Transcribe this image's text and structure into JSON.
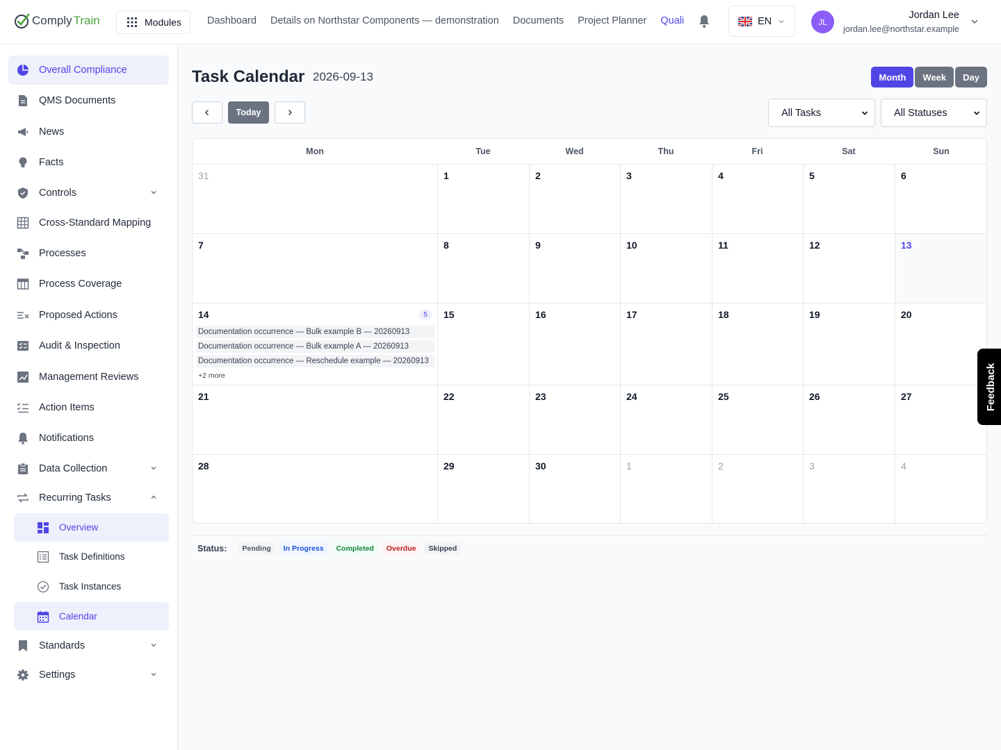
{
  "app": {
    "logo_part1": "Comply",
    "logo_part2": "Train"
  },
  "header": {
    "modules_label": "Modules",
    "nav": [
      "Dashboard",
      "Details on Northstar Components — demonstration",
      "Documents",
      "Project Planner",
      "Quali"
    ],
    "language": "EN",
    "user_initials": "JL",
    "user_name": "Jordan Lee",
    "user_email": "jordan.lee@northstar.example"
  },
  "sidebar": {
    "items": [
      {
        "label": "Overall Compliance"
      },
      {
        "label": "QMS Documents"
      },
      {
        "label": "News"
      },
      {
        "label": "Facts"
      },
      {
        "label": "Controls"
      },
      {
        "label": "Cross-Standard Mapping"
      },
      {
        "label": "Processes"
      },
      {
        "label": "Process Coverage"
      },
      {
        "label": "Proposed Actions"
      },
      {
        "label": "Audit & Inspection"
      },
      {
        "label": "Management Reviews"
      },
      {
        "label": "Action Items"
      },
      {
        "label": "Notifications"
      },
      {
        "label": "Data Collection"
      },
      {
        "label": "Recurring Tasks"
      },
      {
        "label": "Standards"
      },
      {
        "label": "Settings"
      }
    ],
    "subitems": [
      {
        "label": "Overview"
      },
      {
        "label": "Task Definitions"
      },
      {
        "label": "Task Instances"
      },
      {
        "label": "Calendar"
      }
    ]
  },
  "calendar": {
    "title": "Task Calendar",
    "date": "2026-09-13",
    "views": [
      "Month",
      "Week",
      "Day"
    ],
    "active_view": "Month",
    "today_label": "Today",
    "task_filter": "All Tasks",
    "status_filter": "All Statuses",
    "weekdays": [
      "Mon",
      "Tue",
      "Wed",
      "Thu",
      "Fri",
      "Sat",
      "Sun"
    ],
    "weeks": [
      [
        "31",
        "1",
        "2",
        "3",
        "4",
        "5",
        "6"
      ],
      [
        "7",
        "8",
        "9",
        "10",
        "11",
        "12",
        "13"
      ],
      [
        "14",
        "15",
        "16",
        "17",
        "18",
        "19",
        "20"
      ],
      [
        "21",
        "22",
        "23",
        "24",
        "25",
        "26",
        "27"
      ],
      [
        "28",
        "29",
        "30",
        "1",
        "2",
        "3",
        "4"
      ]
    ],
    "event_day": {
      "count": "5",
      "events": [
        "Documentation occurrence — Bulk example B — 20260913",
        "Documentation occurrence — Bulk example A — 20260913",
        "Documentation occurrence — Reschedule example — 20260913"
      ],
      "more": "+2 more"
    }
  },
  "legend": {
    "label": "Status:",
    "statuses": [
      "Pending",
      "In Progress",
      "Completed",
      "Overdue",
      "Skipped"
    ]
  },
  "feedback_label": "Feedback",
  "colors": {
    "accent": "#4f46e5",
    "logo_green": "#4ca23c",
    "avatar": "#8b5cf6"
  }
}
